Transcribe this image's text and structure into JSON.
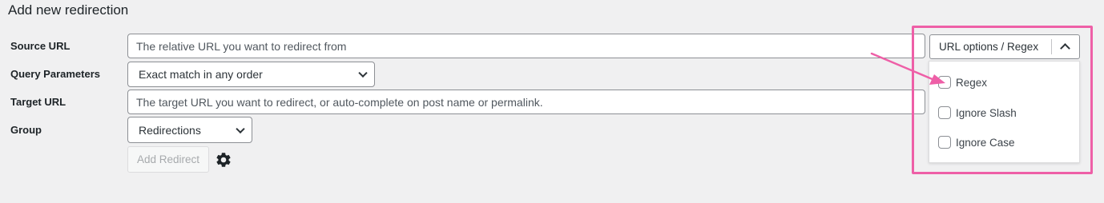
{
  "form": {
    "title": "Add new redirection",
    "source_url": {
      "label": "Source URL",
      "placeholder": "The relative URL you want to redirect from"
    },
    "query_parameters": {
      "label": "Query Parameters",
      "value": "Exact match in any order"
    },
    "target_url": {
      "label": "Target URL",
      "placeholder": "The target URL you want to redirect, or auto-complete on post name or permalink."
    },
    "group": {
      "label": "Group",
      "value": "Redirections"
    },
    "add_button": "Add Redirect"
  },
  "url_options": {
    "button_label": "URL options / Regex",
    "items": [
      {
        "label": "Regex",
        "checked": false
      },
      {
        "label": "Ignore Slash",
        "checked": false
      },
      {
        "label": "Ignore Case",
        "checked": false
      }
    ]
  },
  "colors": {
    "highlight": "#ee5fa7",
    "background": "#f0f0f1",
    "border": "#8c8f94"
  }
}
